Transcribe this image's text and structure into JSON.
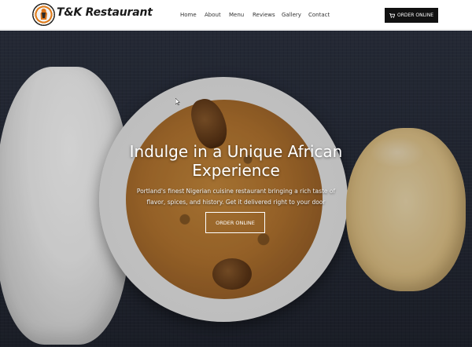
{
  "header": {
    "brand": "T&K Restaurant",
    "nav": [
      "Home",
      "About",
      "Menu",
      "Reviews",
      "Gallery",
      "Contact"
    ],
    "order_button": "ORDER ONLINE",
    "order_icon": "cart-icon"
  },
  "hero": {
    "title": "Indulge in a Unique African Experience",
    "subtitle": "Portland's finest Nigerian cuisine restaurant bringing a rich taste of flavor, spices, and history. Get it delivered right to your door",
    "button": "ORDER ONLINE"
  },
  "colors": {
    "header_bg": "#ffffff",
    "button_bg": "#111111",
    "accent": "#e07a18"
  }
}
